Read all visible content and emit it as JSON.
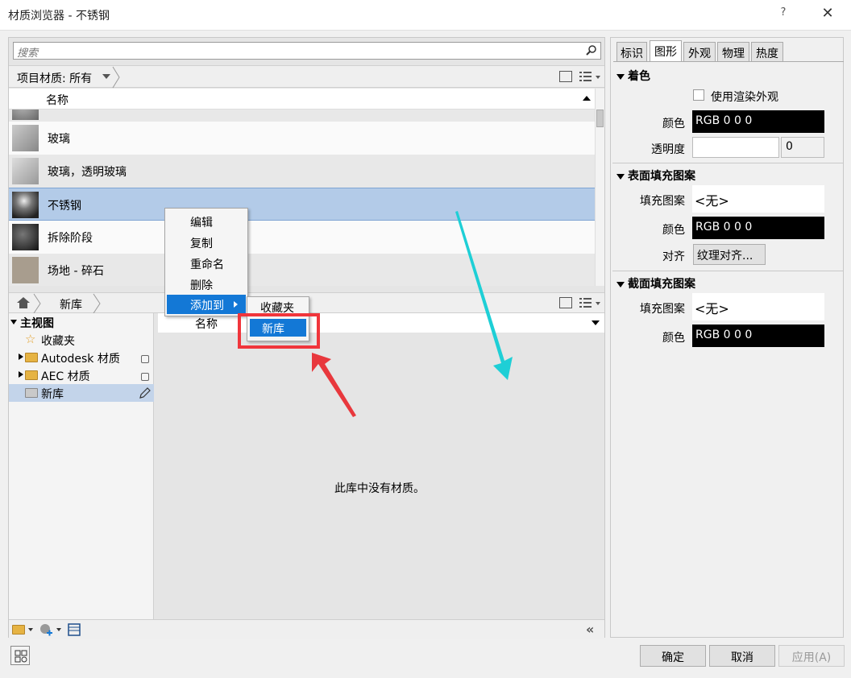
{
  "window": {
    "title": "材质浏览器 - 不锈钢",
    "help": "?",
    "close": "✕"
  },
  "search": {
    "placeholder": "搜索"
  },
  "project_bar": {
    "label": "项目材质: 所有"
  },
  "list": {
    "header": "名称",
    "rows": [
      {
        "label": "玻璃",
        "thumb": "glass"
      },
      {
        "label": "玻璃，透明玻璃",
        "thumb": "clear-glass"
      },
      {
        "label": "不锈钢",
        "thumb": "steel"
      },
      {
        "label": "拆除阶段",
        "thumb": "demolition"
      },
      {
        "label": "场地 - 碎石",
        "thumb": "gravel"
      }
    ]
  },
  "library_bar": {
    "crumb": "新库"
  },
  "tree": {
    "root": "主视图",
    "items": [
      {
        "label": "收藏夹"
      },
      {
        "label": "Autodesk 材质"
      },
      {
        "label": "AEC 材质"
      },
      {
        "label": "新库"
      }
    ]
  },
  "library": {
    "header": "名称",
    "empty": "此库中没有材质。"
  },
  "context_menu": {
    "items": [
      "编辑",
      "复制",
      "重命名",
      "删除",
      "添加到"
    ],
    "submenu": [
      "收藏夹",
      "新库"
    ]
  },
  "right_panel": {
    "tabs": [
      "标识",
      "图形",
      "外观",
      "物理",
      "热度"
    ],
    "shading": {
      "title": "着色",
      "use_render": "使用渲染外观",
      "color_label": "颜色",
      "color_value": "RGB 0 0 0",
      "transparency_label": "透明度",
      "transparency_value": "0"
    },
    "surface": {
      "title": "表面填充图案",
      "pattern_label": "填充图案",
      "pattern_value": "<无>",
      "color_label": "颜色",
      "color_value": "RGB 0 0 0",
      "align_label": "对齐",
      "align_button": "纹理对齐..."
    },
    "cut": {
      "title": "截面填充图案",
      "pattern_label": "填充图案",
      "pattern_value": "<无>",
      "color_label": "颜色",
      "color_value": "RGB 0 0 0"
    }
  },
  "buttons": {
    "ok": "确定",
    "cancel": "取消",
    "apply": "应用(A)"
  },
  "colors": {
    "selection": "#1378d6",
    "highlight_box": "#f0353b",
    "arrow_red": "#e8383d",
    "arrow_cyan": "#1ecfd6"
  }
}
